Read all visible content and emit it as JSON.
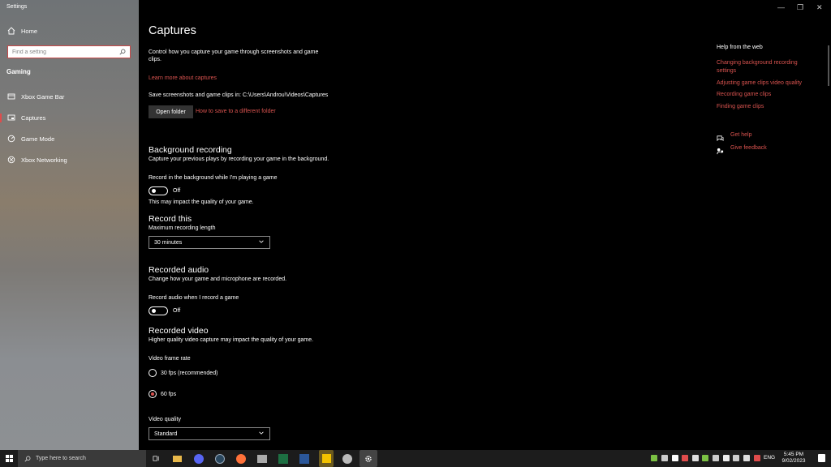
{
  "window": {
    "title": "Settings",
    "minimize_glyph": "—",
    "restore_glyph": "❐",
    "close_glyph": "✕"
  },
  "sidebar": {
    "home_label": "Home",
    "search_placeholder": "Find a setting",
    "section_heading": "Gaming",
    "items": [
      {
        "label": "Xbox Game Bar",
        "icon": "xbox-game-bar-icon"
      },
      {
        "label": "Captures",
        "icon": "captures-icon"
      },
      {
        "label": "Game Mode",
        "icon": "game-mode-icon"
      },
      {
        "label": "Xbox Networking",
        "icon": "xbox-icon"
      }
    ],
    "active_index": 1
  },
  "main": {
    "title": "Captures",
    "intro_line1": "Control how you capture your game through screenshots and game",
    "intro_line2": "clips.",
    "learn_more": "Learn more about captures",
    "save_path_text": "Save screenshots and game clips in: C:\\Users\\Androu\\Videos\\Captures",
    "open_folder": "Open folder",
    "different_folder_link": "How to save to a different folder",
    "background_recording": {
      "heading": "Background recording",
      "description": "Capture your previous plays by recording your game in the background.",
      "toggle_label": "Record in the background while I'm playing a game",
      "toggle_state": "Off",
      "note": "This may impact the quality of your game."
    },
    "record_this": {
      "heading": "Record this",
      "label": "Maximum recording length",
      "value": "30 minutes"
    },
    "recorded_audio": {
      "heading": "Recorded audio",
      "description": "Change how your game and microphone are recorded.",
      "toggle_label": "Record audio when I record a game",
      "toggle_state": "Off"
    },
    "recorded_video": {
      "heading": "Recorded video",
      "description": "Higher quality video capture may impact the quality of your game.",
      "frame_rate_label": "Video frame rate",
      "options": [
        "30 fps (recommended)",
        "60 fps"
      ],
      "selected_option": "60 fps",
      "quality_label": "Video quality",
      "quality_value": "Standard"
    }
  },
  "help": {
    "heading": "Help from the web",
    "links": [
      "Changing background recording settings",
      "Adjusting game clips video quality",
      "Recording game clips",
      "Finding game clips"
    ],
    "get_help": "Get help",
    "give_feedback": "Give feedback"
  },
  "taskbar": {
    "search_placeholder": "Type here to search",
    "language": "ENG",
    "time": "5:45 PM",
    "date": "9/02/2023",
    "accent": "#d9534f"
  }
}
